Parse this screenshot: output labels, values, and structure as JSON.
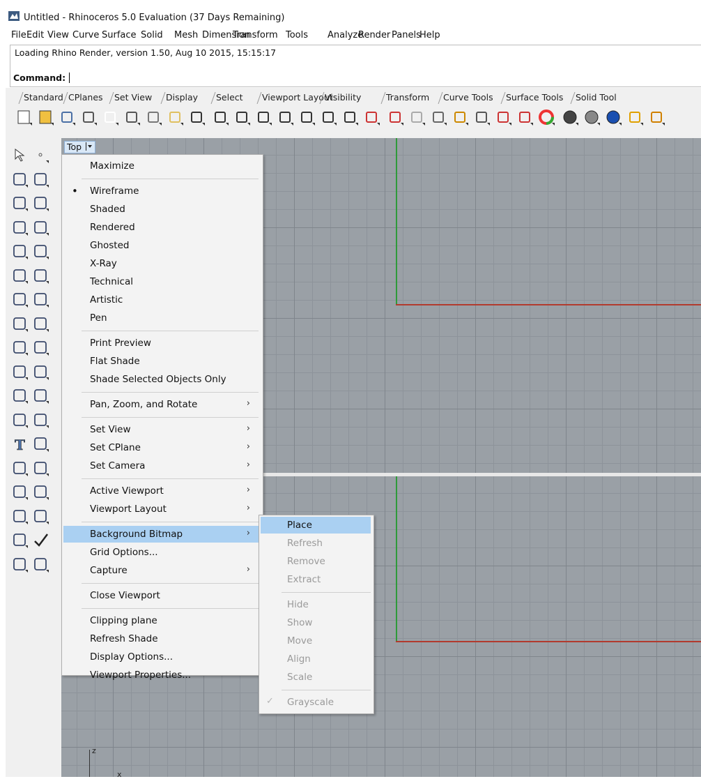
{
  "window": {
    "title": "Untitled - Rhinoceros 5.0 Evaluation (37 Days Remaining)",
    "icon": "rhino-app-icon"
  },
  "menubar": [
    "File",
    "Edit",
    "View",
    "Curve",
    "Surface",
    "Solid",
    "Mesh",
    "Dimension",
    "Transform",
    "Tools",
    "Analyze",
    "Render",
    "Panels",
    "Help"
  ],
  "history": {
    "text": "Loading Rhino Render, version 1.50, Aug 10 2015, 15:15:17"
  },
  "command": {
    "label": "Command:",
    "value": ""
  },
  "toolbar_tabs": [
    "Standard",
    "CPlanes",
    "Set View",
    "Display",
    "Select",
    "Viewport Layout",
    "Visibility",
    "Transform",
    "Curve Tools",
    "Surface Tools",
    "Solid Tool"
  ],
  "active_tab": "Standard",
  "viewport": {
    "label": "Top",
    "dropdown_icon": "viewport-dropdown-icon"
  },
  "context_menu": [
    {
      "label": "Maximize"
    },
    {
      "sep": true
    },
    {
      "label": "Wireframe",
      "bullet": true
    },
    {
      "label": "Shaded"
    },
    {
      "label": "Rendered"
    },
    {
      "label": "Ghosted"
    },
    {
      "label": "X-Ray"
    },
    {
      "label": "Technical"
    },
    {
      "label": "Artistic"
    },
    {
      "label": "Pen"
    },
    {
      "sep": true
    },
    {
      "label": "Print Preview"
    },
    {
      "label": "Flat Shade"
    },
    {
      "label": "Shade Selected Objects Only"
    },
    {
      "sep": true
    },
    {
      "label": "Pan, Zoom, and Rotate",
      "submenu": true
    },
    {
      "sep": true
    },
    {
      "label": "Set View",
      "submenu": true
    },
    {
      "label": "Set CPlane",
      "submenu": true
    },
    {
      "label": "Set Camera",
      "submenu": true
    },
    {
      "sep": true
    },
    {
      "label": "Active Viewport",
      "submenu": true
    },
    {
      "label": "Viewport Layout",
      "submenu": true
    },
    {
      "sep": true
    },
    {
      "label": "Background Bitmap",
      "submenu": true,
      "highlighted": true
    },
    {
      "label": "Grid Options..."
    },
    {
      "label": "Capture",
      "submenu": true
    },
    {
      "sep": true
    },
    {
      "label": "Close Viewport"
    },
    {
      "sep": true
    },
    {
      "label": "Clipping plane"
    },
    {
      "label": "Refresh Shade"
    },
    {
      "label": "Display Options..."
    },
    {
      "label": "Viewport Properties..."
    }
  ],
  "submenu": [
    {
      "label": "Place",
      "highlighted": true
    },
    {
      "label": "Refresh",
      "disabled": true
    },
    {
      "label": "Remove",
      "disabled": true
    },
    {
      "label": "Extract",
      "disabled": true
    },
    {
      "sep": true
    },
    {
      "label": "Hide",
      "disabled": true
    },
    {
      "label": "Show",
      "disabled": true
    },
    {
      "label": "Move",
      "disabled": true
    },
    {
      "label": "Align",
      "disabled": true
    },
    {
      "label": "Scale",
      "disabled": true
    },
    {
      "sep": true
    },
    {
      "label": "Grayscale",
      "disabled": true,
      "checked": true
    }
  ],
  "axes": {
    "z": "z",
    "x": "x"
  },
  "colors": {
    "viewport_bg": "#9aa0a6",
    "x_axis": "#b23a2e",
    "y_axis": "#2f9a3a",
    "highlight": "#aad0f2",
    "menu_bg": "#f3f3f3"
  }
}
